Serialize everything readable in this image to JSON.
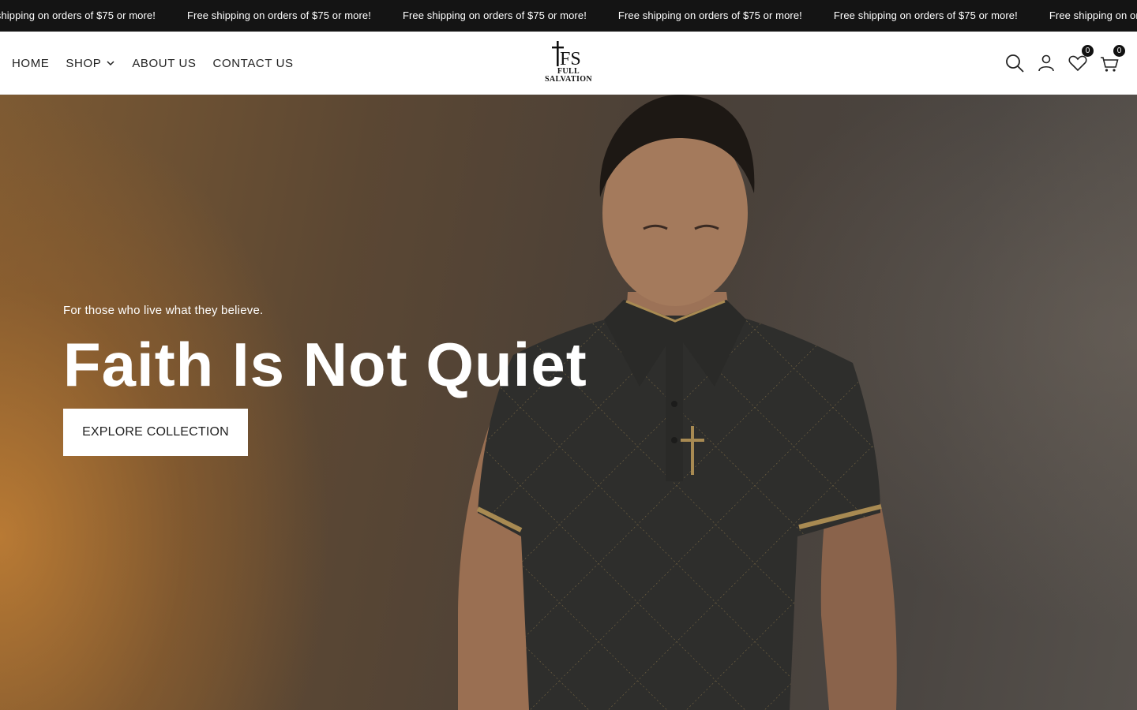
{
  "announcement": {
    "messages": [
      "Free shipping on orders of $75 or more!",
      "Free shipping on orders of $75 or more!",
      "Free shipping on orders of $75 or more!",
      "Free shipping on orders of $75 or more!",
      "Free shipping on orders of $75 or more!",
      "Free shipping on orders of $75 or more!"
    ]
  },
  "nav": {
    "items": [
      {
        "label": "HOME",
        "has_dropdown": false
      },
      {
        "label": "SHOP",
        "has_dropdown": true
      },
      {
        "label": "ABOUT US",
        "has_dropdown": false
      },
      {
        "label": "CONTACT US",
        "has_dropdown": false
      }
    ]
  },
  "logo": {
    "monogram": "FS",
    "line1": "FULL",
    "line2": "SALVATION"
  },
  "header_icons": {
    "search": "search-icon",
    "account": "user-icon",
    "wishlist": "heart-icon",
    "wishlist_count": "0",
    "cart": "shopping-bag-icon",
    "cart_count": "0"
  },
  "hero": {
    "subtitle": "For those who live what they believe.",
    "title": "Faith Is Not Quiet",
    "cta_label": "EXPLORE COLLECTION"
  },
  "colors": {
    "announcement_bg": "#141414",
    "accent_gold": "#a88a52",
    "hero_warm": "#c48034",
    "shirt": "#2e2e2c"
  }
}
